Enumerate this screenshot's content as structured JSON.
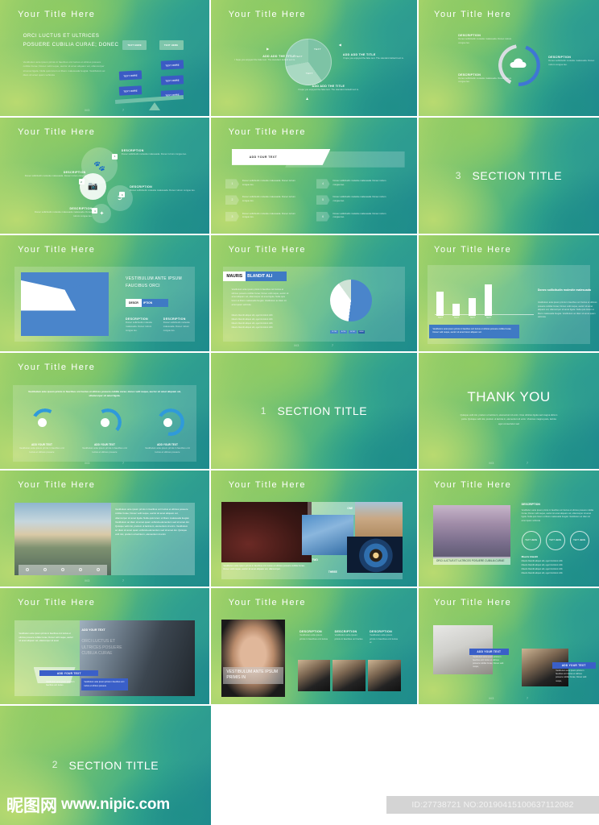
{
  "page": {
    "watermark_cn": "昵图网",
    "watermark_url": "www.nipic.com",
    "id_text": "ID:27738721 NO:20190415100637112082"
  },
  "common": {
    "title": "Your  Title  Here",
    "foot_left": "M3",
    "foot_right": "7",
    "description_label": "DESCRIPTION",
    "lorem_short": "Donec sollicitudin molestie malesuada. Donec rutrum congue leo.",
    "lorem_mid": "Vestibulum ante ipsum primis in faucibus orci luctus et ultrices posuere cubilia Curae; Donec velit neque, auctor sit amet aliquam vel, ullamcorper sit amet ligula.",
    "add_your_text": "ADD YOUR TEXT",
    "text_here": "TEXT HERE"
  },
  "slides": [
    {
      "n": 1,
      "kind": "balance",
      "title": "Your  Title  Here",
      "heading": "ORCI LUCTUS ET ULTRICES POSUERE CUBILIA CURAE; DONEC",
      "body": "Vestibulum ante ipsum primis in faucibus orci luctus et ultrices posuere cubilia Curae; Donec velit neque, auctor sit amet aliquam vel, ullamcorper sit amet ligula. Nulla quis lorem ut libero malesuada feugiat. Vestibulum ac diam sit amet quam vehicula",
      "chips": [
        "TEXT HERE",
        "TEXT HERE",
        "TEXT HERE",
        "TEXT HERE",
        "TEXT HERE",
        "TEXT HERE",
        "TEXT HERE"
      ]
    },
    {
      "n": 2,
      "kind": "pie3",
      "title": "Your  Title  Here",
      "slice_labels": [
        "TEXT",
        "TEXT",
        "TEXT"
      ],
      "callouts": [
        {
          "title": "ADD ADD THE TITLE",
          "body": "I hope you enjoyed the fake text. The standard default text is."
        },
        {
          "title": "ADD ADD THE TITLE",
          "body": "I hope you enjoyed the fake text. The standard default text is."
        },
        {
          "title": "ADD ADD THE TITLE",
          "body": "I hope you enjoyed the fake text. The standard default text is."
        }
      ]
    },
    {
      "n": 3,
      "kind": "ring",
      "title": "Your  Title  Here",
      "callouts": [
        {
          "title": "DESCRIPTION",
          "body": "Donec sollicitudin molestie malesuada. Donec rutrum congue leo."
        },
        {
          "title": "DESCRIPTION",
          "body": "Donec sollicitudin molestie malesuada. Donec rutrum congue leo."
        },
        {
          "title": "DESCRIPTION",
          "body": "Donec sollicitudin molestie malesuada. Donec rutrum congue leo."
        }
      ]
    },
    {
      "n": 4,
      "kind": "bubbles",
      "title": "Your  Title  Here",
      "items": [
        {
          "num": "1",
          "title": "DESCRIPTION",
          "body": "Donec sollicitudin molestie malesuada. Donec rutrum congue leo.",
          "icon": "paw-icon"
        },
        {
          "num": "2",
          "title": "DESCRIPTION",
          "body": "Donec sollicitudin molestie malesuada. Donec rutrum congue leo.",
          "icon": "camera-icon"
        },
        {
          "num": "3",
          "title": "DESCRIPTION",
          "body": "Donec sollicitudin molestie malesuada. Donec rutrum congue leo.",
          "icon": "cursor-icon"
        },
        {
          "num": "4",
          "title": "DESCRIPTION",
          "body": "Donec sollicitudin molestie malesuada malesuada. Donec rutrum congue leo.",
          "icon": "leaf-icon"
        }
      ]
    },
    {
      "n": 5,
      "kind": "banner-list",
      "title": "Your  Title  Here",
      "banner": "ADD YOUR TEXT",
      "rows": [
        {
          "num": "1",
          "text": "Donec sollicitudin molestie malesuada. Donec rutrum congue leo."
        },
        {
          "num": "2",
          "text": "Donec sollicitudin molestie malesuada. Donec rutrum congue leo."
        },
        {
          "num": "3",
          "text": "Donec sollicitudin molestie malesuada. Donec rutrum congue leo."
        },
        {
          "num": "4",
          "text": "Donec sollicitudin molestie malesuada. Donec rutrum congue leo."
        },
        {
          "num": "5",
          "text": "Donec sollicitudin molestie malesuada. Donec rutrum congue leo."
        },
        {
          "num": "6",
          "text": "Donec sollicitudin molestie malesuada. Donec rutrum congue leo."
        }
      ]
    },
    {
      "n": 6,
      "kind": "section",
      "number": "3",
      "label": "SECTION TITLE"
    },
    {
      "n": 7,
      "kind": "area",
      "title": "Your  Title  Here",
      "heading": "VESTIBULUM ANTE IPSUM FAUCIBUS ORCI",
      "tab_active": "DESCR",
      "tab_rest": "IPTION",
      "cols": [
        {
          "title": "DESCRIPTION",
          "body": "Donec sollicitudin molestie malesuada. Donec rutrum congue leo."
        },
        {
          "title": "DESCRIPTION",
          "body": "Donec sollicitudin molestie malesuada. Donec rutrum congue leo."
        }
      ]
    },
    {
      "n": 8,
      "kind": "pie-split",
      "title": "Your  Title  Here",
      "tag_dark": "MAURIS",
      "tag_blue": "BLANDIT ALI",
      "body": "Vestibulum ante ipsum primis in faucibus orci luctus et ultrices posuere cubilia Curae; Donec velit neque, auctor sit amet aliquam vel, ullamcorper sit amet ligula. Nulla quis lorem ut libero malesuada feugiat. Vestibulum ac diam sit amet quam vehicula",
      "bullets": [
        "Mauris blandit aliquet elit, eget tincidunt nibh",
        "Mauris blandit aliquet elit, eget tincidunt nibh",
        "Mauris blandit aliquet elit, eget tincidunt nibh",
        "Mauris blandit aliquet elit, eget tincidunt nibh"
      ],
      "legend": [
        "B-TM",
        "B-TM",
        "B-TM",
        "BDM"
      ]
    },
    {
      "n": 9,
      "kind": "bars",
      "title": "Your  Title  Here",
      "bar_labels": [
        "TEXT",
        "TEXT",
        "TEXT",
        "TEXT"
      ],
      "bar_values": [
        62,
        30,
        45,
        80
      ],
      "side_title": "Donec sollicitudin molestie malesuada",
      "side_body": "Vestibulum ante ipsum primis in faucibus orci luctus et ultrices posuere cubilia Curae; Donec velit neque, auctor sit amet aliquam vel, ullamcorper sit amet ligula. Nulla quis lorem ut libero malesuada feugiat. Vestibulum ac diam sit amet quam vehicula",
      "note": "Vestibulum ante ipsum primis in faucibus orci luctus et ultrices posuere cubilia Curae; Donec velit neque, auctor sit amet lorem aliquam vel."
    },
    {
      "n": 10,
      "kind": "donuts",
      "title": "Your  Title  Here",
      "intro": "Vestibulum ante ipsum primis in faucibus orci luctus et ultrices posuere cubilia curae; donec velit neque, auctor sit amet aliquam vel, ullamcorper sit amet ligula.",
      "items": [
        {
          "label": "ADD YOUR TEXT",
          "body": "Vestibulum ante ipsum primis in faucibus orci luctus et ultrices posuere",
          "pct": 25
        },
        {
          "label": "ADD YOUR TEXT",
          "body": "Vestibulum ante ipsum primis in faucibus orci luctus et ultrices posuere",
          "pct": 45
        },
        {
          "label": "ADD YOUR TEXT",
          "body": "Vestibulum ante ipsum primis in faucibus orci luctus et ultrices posuere",
          "pct": 70
        }
      ]
    },
    {
      "n": 11,
      "kind": "section",
      "number": "1",
      "label": "SECTION TITLE"
    },
    {
      "n": 12,
      "kind": "thanks",
      "heading": "THANK YOU",
      "body": "Quisque velit nisi, pretium ut lacinia in, elementum id enim. Cras ultricies ligula sed magna dictum porta. Quisque velit nisi, pretium ut lacinia in, elementum id enim. Vivamus magna justo, lacinia eget consectetur sed"
    },
    {
      "n": 13,
      "kind": "photo-text",
      "title": "Your  Title  Here",
      "body": "Vestibulum ante ipsum primis in faucibus orci luctus et ultrices posuere cubilia Curae; Donec velit neque, auctor sit amet aliquam vel, ullamcorper sit amet ligula. Nulla quis lorem ut libero malesuada feugiat. Vestibulum ac diam sit amet quam vehicula elementum sed sit amet dui. Quisque velit nisi, pretium ut lacinia in, elementum id enim. Vestibulum ac diam sit amet quam vehicula elementum sed sit amet dui. Quisque velit nisi, pretium ut lacinia in, elementum id enim",
      "icons": [
        "home-icon",
        "search-icon",
        "user-icon",
        "mail-icon",
        "clock-icon"
      ]
    },
    {
      "n": 14,
      "kind": "collage",
      "title": "Your  Title  Here",
      "tags": [
        "ONE",
        "TWO",
        "THREE"
      ],
      "caption": "Vestibulum ante ipsum primis in faucibus orci luctus et ultrices posuere cubilia Curae; Donec velit neque, auctor sit amet aliquam vel, ullamcorper."
    },
    {
      "n": 15,
      "kind": "tree-desc",
      "title": "Your  Title  Here",
      "caption": "ORCI LUCTUS ET ULTRICES POSUERE CUBILIA CURAE",
      "desc_title": "DESCRIPTION",
      "desc_body": "Vestibulum ante ipsum primis in faucibus orci luctus et ultrices posuere cubilia Curae; Donec velit neque, auctor sit amet aliquam vel, ullamcorper sit amet ligula. Nulla quis lorem ut libero malesuada feugiat. Vestibulum ac diam sit amet quam vehicula",
      "circles": [
        "TEXT HERE",
        "TEXT HERE",
        "TEXT HERE"
      ],
      "bullet_title": "Mauris blandit",
      "bullets": [
        "Mauris blandit aliquet elit, eget tincidunt nibh",
        "Mauris blandit aliquet elit, eget tincidunt nibh",
        "Mauris blandit aliquet elit, eget tincidunt nibh",
        "Mauris blandit aliquet elit, eget tincidunt nibh"
      ]
    },
    {
      "n": 16,
      "kind": "cabin",
      "title": "Your  Title  Here",
      "left_body": "Vestibulum ante ipsum primis in faucibus orci luctus et ultrices posuere cubilia Curae; Donec velit neque, auctor sit amet aliquam vel, ullamcorper sit amet",
      "badge_top": "ADD YOUR TEXT",
      "overlay_heading": "ORCI LUCTUS ET ULTRICES POSUERE CUBILIA CURAE",
      "badge_mid": "ADD YOUR TEXT",
      "badge_mid_body": "Vestibulum ante ipsum primis in faucibus orci luctus",
      "badge_blue_body": "Vestibulum ante ipsum primis in faucibus orci luctus et ultrices posuere"
    },
    {
      "n": 17,
      "kind": "hands",
      "title": "Your  Title  Here",
      "overlay": "VESTIBULUM ANTE IPSUM PRIMIS IN",
      "cols": [
        {
          "title": "DESCRIPTION",
          "body": "Vestibulum ante ipsum primis in faucibus orci luctus"
        },
        {
          "title": "DESCRIPTION",
          "body": "Vestibulum ante ipsum primis in faucibus orci luctus"
        },
        {
          "title": "DESCRIPTION",
          "body": "Vestibulum ante ipsum primis in faucibus orci luctus et"
        }
      ]
    },
    {
      "n": 18,
      "kind": "two-portraits",
      "title": "Your  Title  Here",
      "badge_a": "ADD YOUR TEXT",
      "body_a": "Vestibulum ante ipsum primis in faucibus orci luctus et ultrices posuere cubilia Curae; Donec velit neque,",
      "badge_b": "ADD YOUR TEXT",
      "body_b": "Vestibulum ante ipsum primis in faucibus orci luctus et ultrices posuere cubilia Curae; Donec velit neque,"
    },
    {
      "n": 19,
      "kind": "section",
      "number": "2",
      "label": "SECTION TITLE"
    }
  ]
}
